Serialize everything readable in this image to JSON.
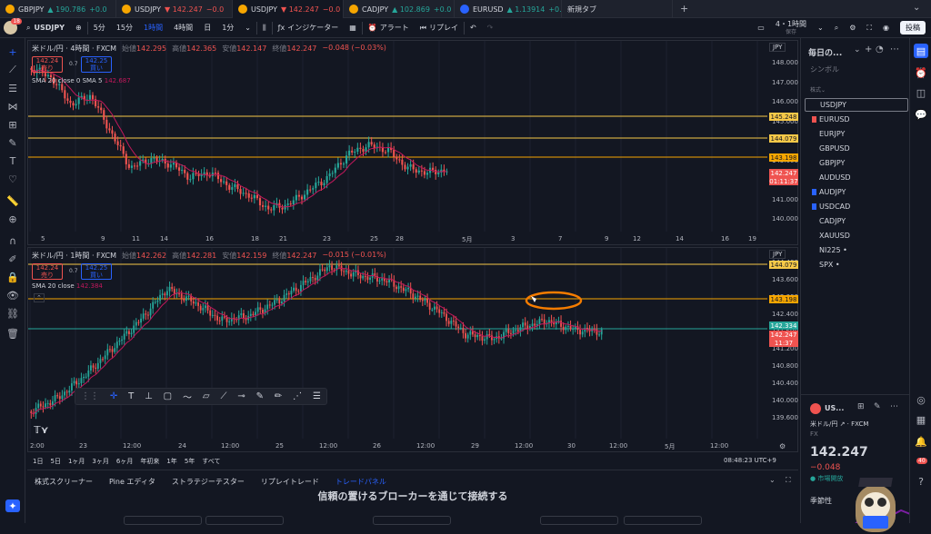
{
  "tabs": [
    {
      "symbol": "GBPJPY",
      "price": "▲ 190.786",
      "change": "+0.0",
      "dir": "up"
    },
    {
      "symbol": "USDJPY",
      "price": "▼ 142.247",
      "change": "−0.0",
      "dir": "dn"
    },
    {
      "symbol": "USDJPY",
      "price": "▼ 142.247",
      "change": "−0.0",
      "dir": "dn",
      "active": true
    },
    {
      "symbol": "CADJPY",
      "price": "▲ 102.869",
      "change": "+0.0",
      "dir": "up"
    },
    {
      "symbol": "EURUSD",
      "price": "▲ 1.13914",
      "change": "+0.0",
      "dir": "up"
    },
    {
      "symbol": "新規タブ",
      "price": "",
      "change": "",
      "dir": ""
    }
  ],
  "toolbar": {
    "symbol": "USDJPY",
    "intervals": [
      "5分",
      "15分",
      "1時間",
      "4時間",
      "日",
      "1分"
    ],
    "indicators": "インジケーター",
    "alert": "アラート",
    "replay": "リプレイ",
    "layout": "4・1時間",
    "layout_sub": "保存",
    "publish": "投稿"
  },
  "pane_top": {
    "title": "米ドル/円 · 4時間 · FXCM",
    "ohlc": {
      "o_label": "始値",
      "o": "142.295",
      "h_label": "高値",
      "h": "142.365",
      "l_label": "安値",
      "l": "142.147",
      "c_label": "終値",
      "c": "142.247",
      "chg": "−0.048 (−0.03%)"
    },
    "bid": {
      "price": "142.24",
      "sup": "8",
      "label": "売り"
    },
    "spread": "0.7",
    "ask": {
      "price": "142.25",
      "sup": "5",
      "label": "買い"
    },
    "indicator": "SMA 20 close 0 SMA 5",
    "indicator_value": "142.687",
    "currency": "JPY",
    "y_ticks": [
      "148.000",
      "147.000",
      "146.000",
      "145.000",
      "144.000",
      "143.000",
      "142.000",
      "141.000",
      "140.000"
    ],
    "price_tags": [
      {
        "text": "145.248",
        "color": "#f7c948"
      },
      {
        "text": "144.079",
        "color": "#f7c948"
      },
      {
        "text": "143.198",
        "color": "#f7a600"
      },
      {
        "text": "142.247",
        "color": "#ef5350"
      },
      {
        "text": "01:11:37",
        "color": "#ef5350"
      }
    ],
    "x_ticks": [
      "5",
      "9",
      "11",
      "14",
      "16",
      "18",
      "21",
      "23",
      "25",
      "28",
      "5月",
      "3",
      "7",
      "9",
      "12",
      "14",
      "16",
      "19"
    ]
  },
  "pane_bottom": {
    "title": "米ドル/円 · 1時間 · FXCM",
    "ohlc": {
      "o_label": "始値",
      "o": "142.262",
      "h_label": "高値",
      "h": "142.281",
      "l_label": "安値",
      "l": "142.159",
      "c_label": "終値",
      "c": "142.247",
      "chg": "−0.015 (−0.01%)"
    },
    "bid": {
      "price": "142.24",
      "sup": "8",
      "label": "売り"
    },
    "spread": "0.7",
    "ask": {
      "price": "142.25",
      "sup": "5",
      "label": "買い"
    },
    "indicator": "SMA 20 close",
    "indicator_value": "142.384",
    "currency": "JPY",
    "y_ticks": [
      "144.400",
      "143.600",
      "143.000",
      "142.400",
      "141.600",
      "141.200",
      "140.800",
      "140.400",
      "140.000",
      "139.600"
    ],
    "price_tags": [
      {
        "text": "144.079",
        "color": "#f7c948"
      },
      {
        "text": "143.198",
        "color": "#f7a600"
      },
      {
        "text": "142.334",
        "color": "#26a69a"
      },
      {
        "text": "142.247",
        "color": "#ef5350"
      },
      {
        "text": "11:37",
        "color": "#ef5350"
      }
    ],
    "x_ticks": [
      "2:00",
      "23",
      "12:00",
      "24",
      "12:00",
      "25",
      "12:00",
      "26",
      "12:00",
      "29",
      "12:00",
      "30",
      "12:00",
      "5月",
      "12:00"
    ]
  },
  "range_bar": {
    "ranges": [
      "1日",
      "5日",
      "1ヶ月",
      "3ヶ月",
      "6ヶ月",
      "年初来",
      "1年",
      "5年",
      "すべて"
    ],
    "clock": "08:48:23 UTC+9"
  },
  "bottom_tabs": [
    "株式スクリーナー",
    "Pine エディタ",
    "ストラテジーテスター",
    "リプレイトレード",
    "トレードパネル"
  ],
  "bottom_message": "信頼の置けるブローカーを通じて接続する",
  "watchlist": {
    "title": "毎日の...",
    "symbol_header": "シンボル",
    "section": "株式",
    "items": [
      "USDJPY",
      "EURUSD",
      "EURJPY",
      "GBPUSD",
      "GBPJPY",
      "AUDUSD",
      "AUDJPY",
      "USDCAD",
      "CADJPY",
      "XAUUSD",
      "NI225 •",
      "SPX •"
    ]
  },
  "detail": {
    "symbol": "US...",
    "name": "米ドル/円",
    "source": "FXCM",
    "type": "FX",
    "price": "142.247",
    "change": "−0.048",
    "status": "市場開放",
    "seasonal": "季節性"
  },
  "user_badge": "18",
  "notif_count": "40",
  "colors": {
    "up": "#26a69a",
    "down": "#ef5350",
    "sma": "#c2185b",
    "accent": "#2962ff",
    "yellow_line": "#f7c948",
    "orange_line": "#f7a600",
    "green_line": "#26a69a"
  }
}
